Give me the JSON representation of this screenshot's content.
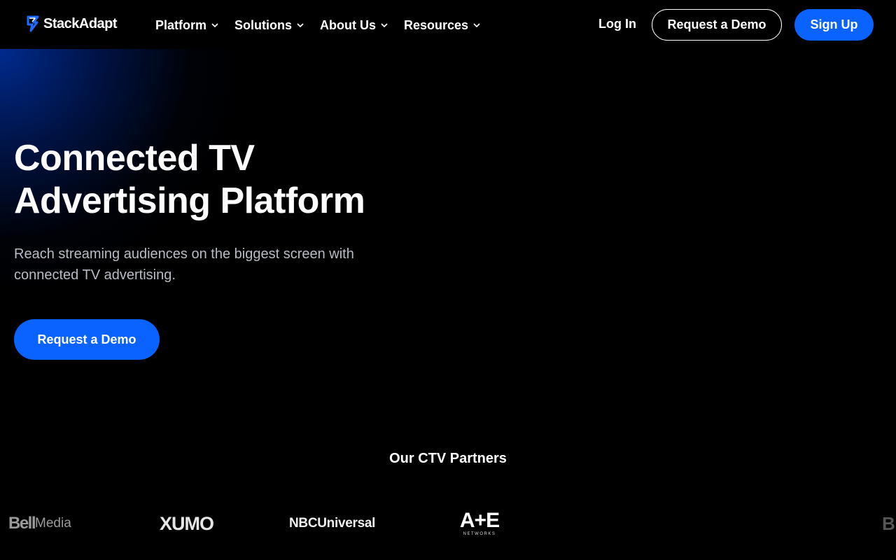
{
  "brand": {
    "name": "StackAdapt",
    "accent": "#0a62ff"
  },
  "nav": {
    "items": [
      {
        "label": "Platform"
      },
      {
        "label": "Solutions"
      },
      {
        "label": "About Us"
      },
      {
        "label": "Resources"
      }
    ],
    "login": "Log In",
    "request_demo": "Request a Demo",
    "sign_up": "Sign Up"
  },
  "hero": {
    "title_line1": "Connected TV",
    "title_line2": "Advertising Platform",
    "subtitle_line1": "Reach streaming audiences on the biggest screen with",
    "subtitle_line2": "connected TV advertising.",
    "cta": "Request a Demo"
  },
  "partners": {
    "title": "Our CTV Partners",
    "logos": [
      {
        "name_a": "Bell",
        "name_b": "Media"
      },
      {
        "name": "XUMO"
      },
      {
        "name": "NBCUniversal"
      },
      {
        "name": "A+E",
        "sub": "NETWORKS"
      },
      {
        "name": "B"
      }
    ]
  }
}
